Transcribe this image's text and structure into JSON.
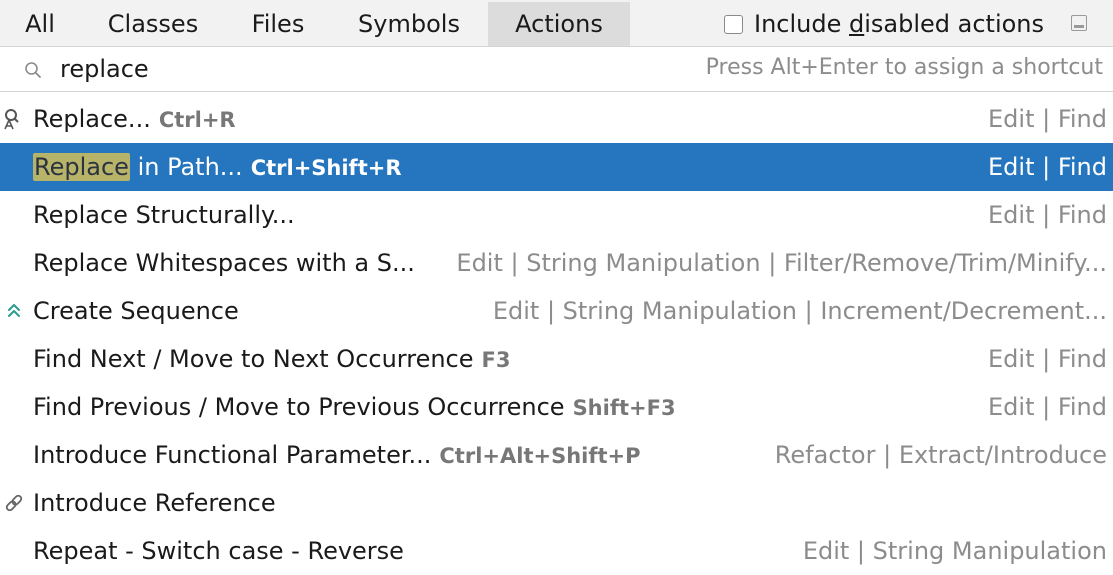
{
  "tabs": [
    {
      "label": "All"
    },
    {
      "label": "Classes"
    },
    {
      "label": "Files"
    },
    {
      "label": "Symbols"
    },
    {
      "label": "Actions"
    }
  ],
  "active_tab": "Actions",
  "include_disabled": {
    "pre": "Include ",
    "mnemonic": "d",
    "post": "isabled actions",
    "checked": false
  },
  "search": {
    "value": "replace",
    "hint": "Press Alt+Enter to assign a shortcut"
  },
  "results": [
    {
      "icon": "replace-icon",
      "highlight": "",
      "name": "Replace...",
      "shortcut": "Ctrl+R",
      "group": "Edit | Find",
      "selected": false
    },
    {
      "icon": "",
      "highlight": "Replace",
      "name": " in Path...",
      "shortcut": "Ctrl+Shift+R",
      "group": "Edit | Find",
      "selected": true
    },
    {
      "icon": "",
      "highlight": "",
      "name": "Replace Structurally...",
      "shortcut": "",
      "group": "Edit | Find",
      "selected": false
    },
    {
      "icon": "",
      "highlight": "",
      "name": "Replace Whitespaces with a S...",
      "shortcut": "",
      "group": "Edit | String Manipulation | Filter/Remove/Trim/Minify...",
      "selected": false
    },
    {
      "icon": "double-chevron-up-icon",
      "highlight": "",
      "name": "Create Sequence",
      "shortcut": "",
      "group": "Edit | String Manipulation | Increment/Decrement...",
      "selected": false
    },
    {
      "icon": "",
      "highlight": "",
      "name": "Find Next / Move to Next Occurrence",
      "shortcut": "F3",
      "group": "Edit | Find",
      "selected": false
    },
    {
      "icon": "",
      "highlight": "",
      "name": "Find Previous / Move to Previous Occurrence",
      "shortcut": "Shift+F3",
      "group": "Edit | Find",
      "selected": false
    },
    {
      "icon": "",
      "highlight": "",
      "name": "Introduce Functional Parameter...",
      "shortcut": "Ctrl+Alt+Shift+P",
      "group": "Refactor | Extract/Introduce",
      "selected": false
    },
    {
      "icon": "link-icon",
      "highlight": "",
      "name": "Introduce Reference",
      "shortcut": "",
      "group": "",
      "selected": false
    },
    {
      "icon": "",
      "highlight": "",
      "name": "Repeat - Switch case - Reverse",
      "shortcut": "",
      "group": "Edit | String Manipulation",
      "selected": false
    }
  ],
  "colors": {
    "selection": "#2675bf",
    "match_highlight": "#b7b46a",
    "muted_text": "#8c8c8c",
    "accent_icon": "#2a9d8f"
  }
}
